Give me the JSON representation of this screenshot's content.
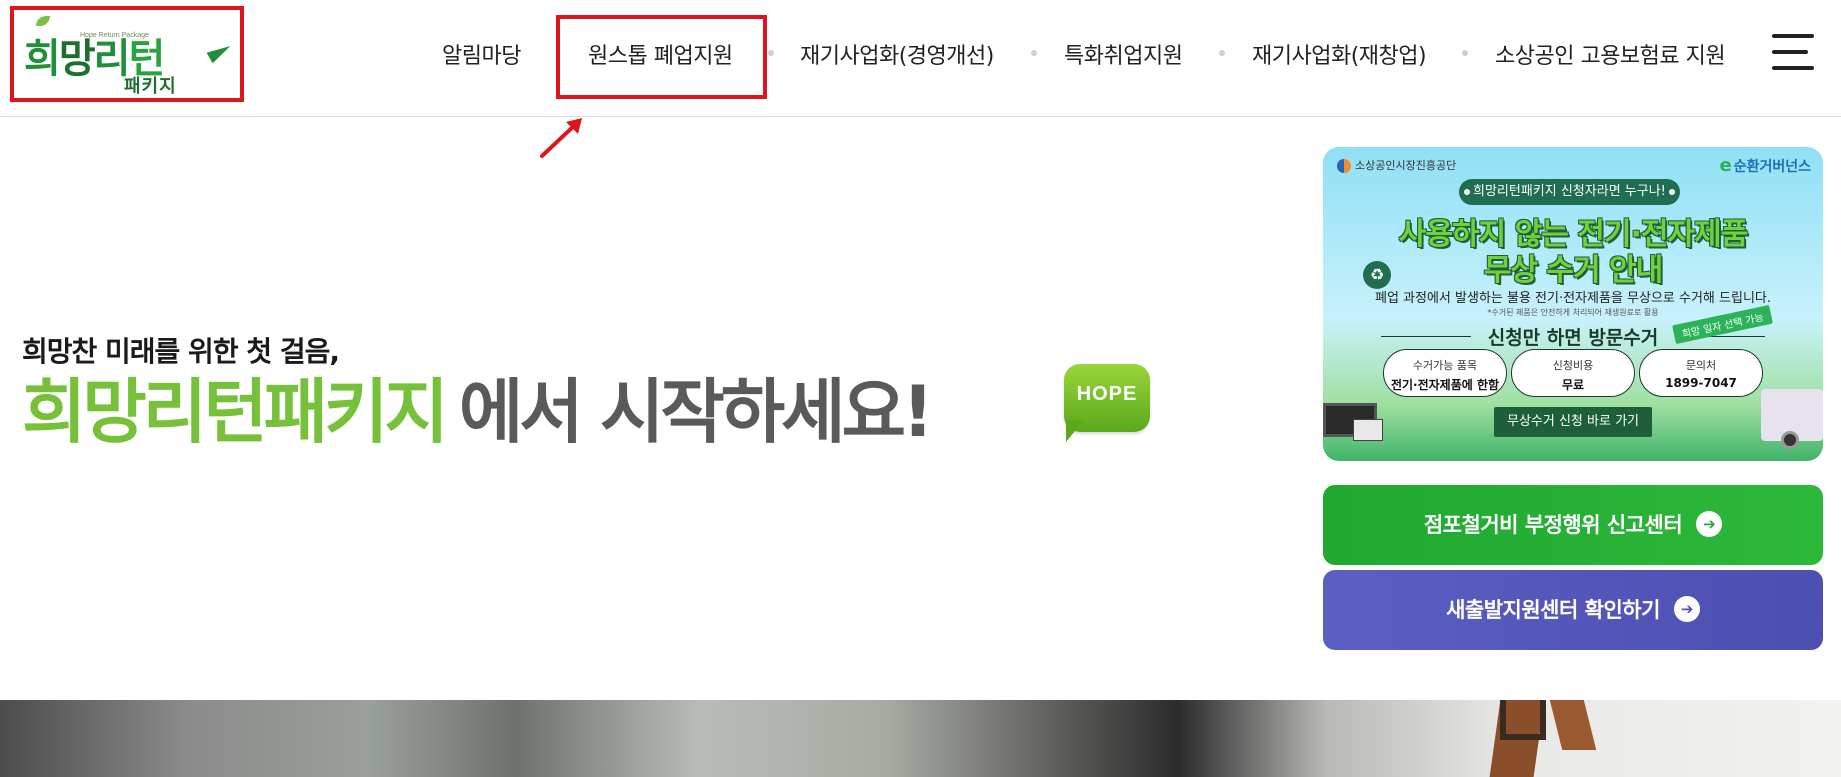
{
  "header": {
    "logo": {
      "tagline_en": "Hope Return Package",
      "name_parts": [
        "희",
        "망",
        "리",
        "턴"
      ],
      "sub": "패키지"
    },
    "nav": [
      {
        "label": "알림마당"
      },
      {
        "label": "원스톱 폐업지원"
      },
      {
        "label": "재기사업화(경영개선)"
      },
      {
        "label": "특화취업지원"
      },
      {
        "label": "재기사업화(재창업)"
      },
      {
        "label": "소상공인 고용보험료 지원"
      }
    ],
    "menu_icon": "hamburger-menu-icon"
  },
  "hero": {
    "subtitle": "희망찬 미래를 위한 첫 걸음,",
    "title_green": "희망리턴패키지",
    "title_gray": "에서 시작하세요!",
    "badge": "HOPE"
  },
  "banner": {
    "org": "소상공인시장진흥공단",
    "partner_mark": "e",
    "partner": "순환거버넌스",
    "pill": "희망리턴패키지 신청자라면 누구나!",
    "headline_1": "사용하지 않는 전기·전자제품",
    "headline_2": "무상 수거 안내",
    "description": "폐업 과정에서 발생하는 불용 전기·전자제품을 무상으로 수거해 드립니다.",
    "note": "*수거된 제품은 안전하게 처리되어 재생원료로 활용",
    "cta": "신청만 하면 방문수거",
    "tag": "희망 일자 선택 가능",
    "boxes": [
      {
        "title": "수거가능 품목",
        "value": "전기·전자제품에 한함"
      },
      {
        "title": "신청비용",
        "value": "무료"
      },
      {
        "title": "문의처",
        "value": "1899-7047"
      }
    ],
    "button": "무상수거 신청 바로 가기"
  },
  "actions": {
    "report": "점포철거비 부정행위 신고센터",
    "carbon": "새출발지원센터 확인하기",
    "arrow_glyph": "➔"
  },
  "colors": {
    "accent_green": "#77c13a",
    "button_green": "#20a830",
    "button_purple": "#4c4fb0",
    "highlight_red": "#e0141e"
  }
}
